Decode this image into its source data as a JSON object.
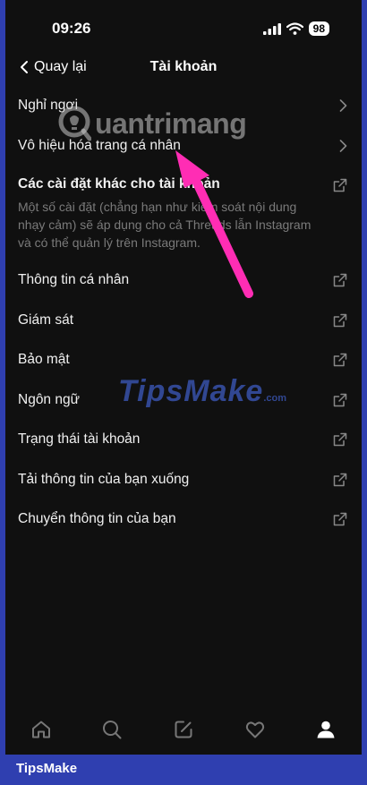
{
  "status_bar": {
    "time": "09:26",
    "battery": "98"
  },
  "nav": {
    "back_label": "Quay lại",
    "title": "Tài khoản"
  },
  "items_top": [
    {
      "label": "Nghỉ ngơi"
    },
    {
      "label": "Vô hiệu hóa trang cá nhân"
    }
  ],
  "other_settings": {
    "title": "Các cài đặt khác cho tài khoản",
    "description": "Một số cài đặt (chẳng hạn như kiểm soát nội dung nhạy cảm) sẽ áp dụng cho cả Threads lẫn Instagram và có thể quản lý trên Instagram."
  },
  "items_external": [
    {
      "label": "Thông tin cá nhân"
    },
    {
      "label": "Giám sát"
    },
    {
      "label": "Bảo mật"
    },
    {
      "label": "Ngôn ngữ"
    },
    {
      "label": "Trạng thái tài khoản"
    },
    {
      "label": "Tải thông tin của bạn xuống"
    },
    {
      "label": "Chuyển thông tin của bạn"
    }
  ],
  "tabbar": [
    "home-icon",
    "search-icon",
    "compose-icon",
    "heart-icon",
    "profile-icon"
  ],
  "watermarks": {
    "primary": "uantrimang",
    "secondary": "TipsMake",
    "secondary_suffix": ".com"
  },
  "footer_brand": "TipsMake",
  "colors": {
    "arrow": "#ff2db4",
    "border": "#2f3fb0"
  }
}
